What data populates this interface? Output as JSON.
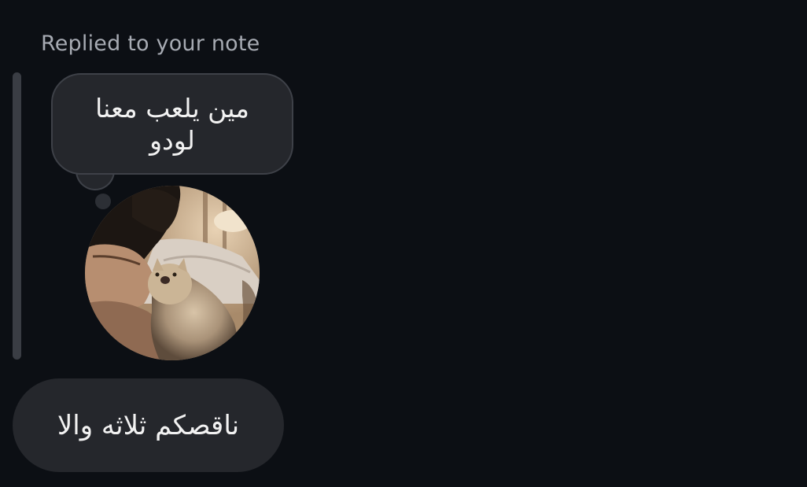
{
  "reply": {
    "label": "Replied to your note"
  },
  "note": {
    "text": "مين يلعب معنا لودو"
  },
  "avatar": {
    "alt": "profile-photo"
  },
  "message": {
    "text": "ناقصكم ثلاثه والا"
  },
  "colors": {
    "background": "#0c0f14",
    "bubble": "#25272c",
    "label": "#a7abb3",
    "text": "#f2f2f2"
  }
}
